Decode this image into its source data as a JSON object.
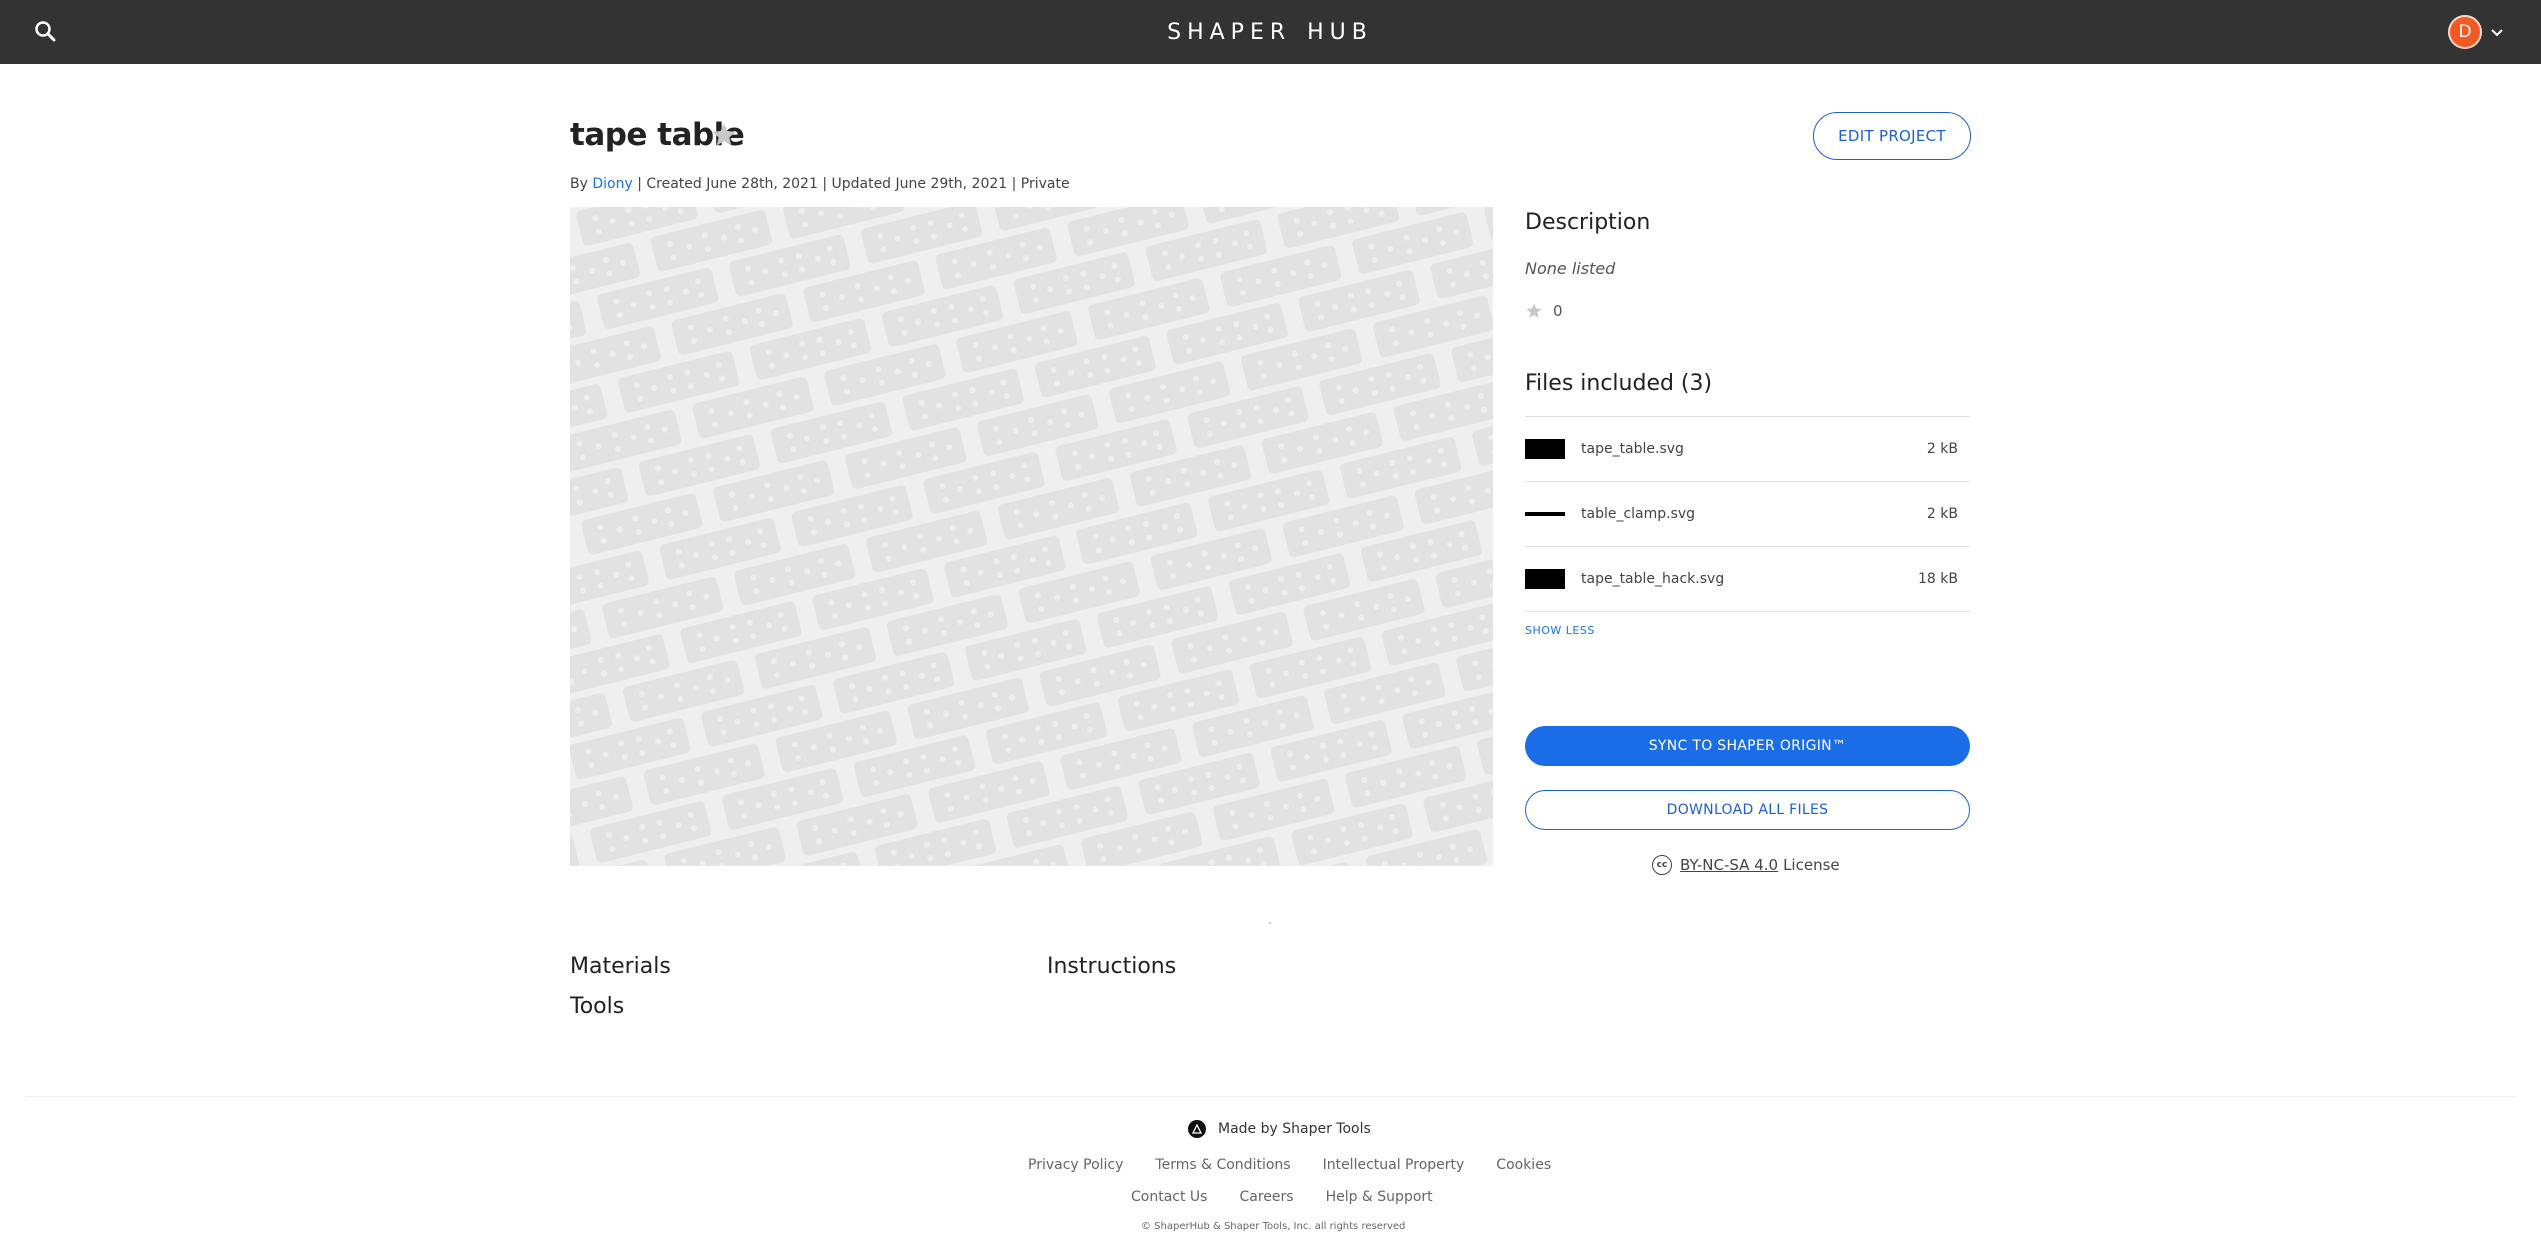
{
  "header": {
    "logo_left": "SHAPER",
    "logo_right": "HUB",
    "avatar_initial": "D",
    "icons": [
      "search-icon",
      "chevron-down-icon"
    ]
  },
  "project": {
    "title": "tape table",
    "meta": {
      "by": "By ",
      "author": "Diony",
      "rest": " | Created June 28th, 2021 | Updated June 29th, 2021 | Private"
    },
    "edit_label": "EDIT PROJECT"
  },
  "description": {
    "heading": "Description",
    "value": "None listed",
    "likes": "0"
  },
  "files": {
    "heading": "Files included (3)",
    "items": [
      {
        "name": "tape_table.svg",
        "size": "2 kB",
        "thumb": "box"
      },
      {
        "name": "table_clamp.svg",
        "size": "2 kB",
        "thumb": "line"
      },
      {
        "name": "tape_table_hack.svg",
        "size": "18 kB",
        "thumb": "box"
      }
    ],
    "show_less": "SHOW LESS"
  },
  "actions": {
    "sync_label": "SYNC TO SHAPER ORIGIN™",
    "download_label": "DOWNLOAD ALL FILES"
  },
  "license": {
    "cc_symbol": "cc",
    "link": "BY-NC-SA 4.0",
    "suffix": "License"
  },
  "sections": {
    "materials": "Materials",
    "tools": "Tools",
    "instructions": "Instructions"
  },
  "footer": {
    "made_by": "Made by Shaper Tools",
    "links_row1": [
      "Privacy Policy",
      "Terms & Conditions",
      "Intellectual Property",
      "Cookies"
    ],
    "links_row2": [
      "Contact Us",
      "Careers",
      "Help & Support"
    ],
    "copyright": "© ShaperHub & Shaper Tools, Inc. all rights reserved"
  },
  "colors": {
    "topbar": "#333333",
    "accent": "#1a6de6",
    "avatar": "#f15a24"
  }
}
